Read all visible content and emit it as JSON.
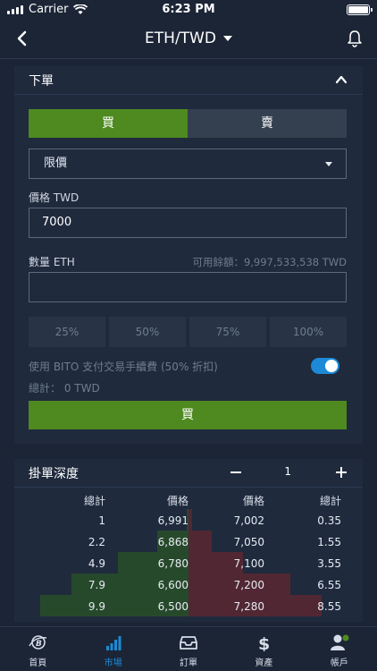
{
  "status_bar": {
    "carrier": "Carrier",
    "time": "6:23 PM"
  },
  "navbar": {
    "title": "ETH/TWD"
  },
  "order_panel": {
    "header": "下單",
    "buy_label": "買",
    "sell_label": "賣",
    "order_type": "限價",
    "price_label": "價格 TWD",
    "price_value": "7000",
    "amount_label": "數量 ETH",
    "available_label": "可用餘額：9,997,533,538 TWD",
    "amount_value": "",
    "percent_options": [
      "25%",
      "50%",
      "75%",
      "100%"
    ],
    "fee_option": "使用 BITO 支付交易手續費 (50% 折扣)",
    "fee_toggle_on": true,
    "total": "總計： 0 TWD",
    "submit_label": "買"
  },
  "depth_panel": {
    "header": "掛單深度",
    "step": "1",
    "columns": [
      "總計",
      "價格",
      "價格",
      "總計"
    ],
    "rows": [
      {
        "bid_total": "1",
        "bid_price": "6,991",
        "ask_price": "7,002",
        "ask_total": "0.35",
        "bid_fill": 0.01,
        "ask_fill": 0.02
      },
      {
        "bid_total": "2.2",
        "bid_price": "6,868",
        "ask_price": "7,050",
        "ask_total": "1.55",
        "bid_fill": 0.2,
        "ask_fill": 0.15
      },
      {
        "bid_total": "4.9",
        "bid_price": "6,780",
        "ask_price": "7,100",
        "ask_total": "3.55",
        "bid_fill": 0.45,
        "ask_fill": 0.35
      },
      {
        "bid_total": "7.9",
        "bid_price": "6,600",
        "ask_price": "7,200",
        "ask_total": "6.55",
        "bid_fill": 0.75,
        "ask_fill": 0.65
      },
      {
        "bid_total": "9.9",
        "bid_price": "6,500",
        "ask_price": "7,280",
        "ask_total": "8.55",
        "bid_fill": 0.95,
        "ask_fill": 0.85
      }
    ]
  },
  "tabbar": {
    "items": [
      {
        "label": "首頁",
        "icon": "home-logo-icon",
        "active": false
      },
      {
        "label": "市場",
        "icon": "market-bars-icon",
        "active": true
      },
      {
        "label": "訂單",
        "icon": "orders-tray-icon",
        "active": false
      },
      {
        "label": "資產",
        "icon": "dollar-icon",
        "active": false
      },
      {
        "label": "帳戶",
        "icon": "account-icon",
        "active": false
      }
    ]
  },
  "colors": {
    "buy": "#4e8a1f",
    "accent": "#1c8ad6",
    "bid_depth": "#27492b",
    "ask_depth": "#512733"
  }
}
